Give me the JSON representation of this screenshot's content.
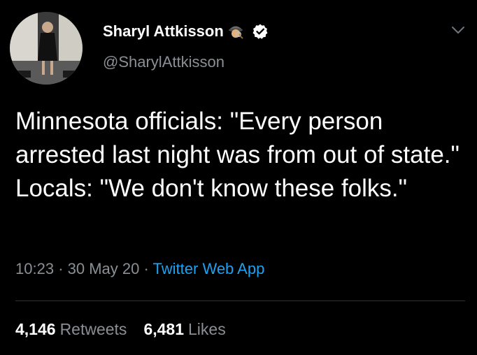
{
  "author": {
    "display_name": "Sharyl Attkisson",
    "handle": "@SharylAttkisson",
    "name_emoji_icon": "detective-emoji-icon",
    "verified_icon": "verified-badge-icon"
  },
  "tweet": {
    "text": "Minnesota officials: \"Every person arrested last night was from out of state.\" Locals: \"We don't know these folks.\"",
    "time": "10:23",
    "separator": "·",
    "date": "30 May 20",
    "source": "Twitter Web App"
  },
  "stats": {
    "retweets_count": "4,146",
    "retweets_label": "Retweets",
    "likes_count": "6,481",
    "likes_label": "Likes"
  },
  "colors": {
    "background": "#000000",
    "text_primary": "#ffffff",
    "text_secondary": "#8a8f94",
    "accent": "#1da1f2",
    "divider": "#2f3336"
  },
  "icons": {
    "menu": "chevron-down-icon"
  }
}
